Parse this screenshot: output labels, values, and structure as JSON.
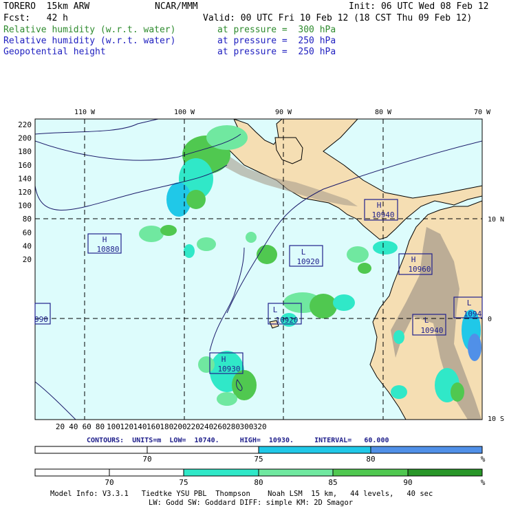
{
  "header": {
    "model": "TORERO  15km ARW",
    "org": "NCAR/MMM",
    "init": "Init: 06 UTC Wed 08 Feb 12",
    "fcst": "Fcst:   42 h",
    "valid": "Valid: 00 UTC Fri 10 Feb 12 (18 CST Thu 09 Feb 12)",
    "fields": [
      {
        "name": "Relative humidity (w.r.t. water)",
        "level": "at pressure =  300 hPa",
        "color": "#2e8b2e"
      },
      {
        "name": "Relative humidity (w.r.t. water)",
        "level": "at pressure =  250 hPa",
        "color": "#2020c0"
      },
      {
        "name": "Geopotential height",
        "level": "at pressure =  250 hPa",
        "color": "#2020c0"
      }
    ]
  },
  "axes": {
    "top_lon_labels": [
      "110 W",
      "100 W",
      "90 W",
      "80 W",
      "70 W"
    ],
    "right_lat_labels": [
      "10 N",
      "0",
      "10 S"
    ],
    "y_ticks": [
      "220",
      "200",
      "180",
      "160",
      "140",
      "120",
      "100",
      "80",
      "60",
      "40",
      "20"
    ],
    "x_ticks": [
      "20",
      "40",
      "60",
      "80",
      "100",
      "120",
      "140",
      "160",
      "180",
      "200",
      "220",
      "240",
      "260",
      "280",
      "300",
      "320"
    ]
  },
  "pressure_centers": [
    {
      "type": "H",
      "value": "10880"
    },
    {
      "type": "L",
      "value": "10920"
    },
    {
      "type": "H",
      "value": "10940"
    },
    {
      "type": "H",
      "value": "10960"
    },
    {
      "type": "L",
      "value": "10920"
    },
    {
      "type": "L",
      "value": "10940"
    },
    {
      "type": "H",
      "value": "10930"
    },
    {
      "type": "L",
      "value": "1094"
    },
    {
      "type": "",
      "value": "990"
    }
  ],
  "contour_info": "CONTOURS:  UNITS=m  LOW=  10740.     HIGH=  10930.     INTERVAL=   60.000",
  "scale1": {
    "labels": [
      "70",
      "75",
      "80"
    ],
    "unit": "%",
    "colors": [
      "#ffffff",
      "#ffffff",
      "#20c8e8",
      "#5090e8"
    ]
  },
  "scale2": {
    "labels": [
      "70",
      "75",
      "80",
      "85",
      "90"
    ],
    "unit": "%",
    "colors": [
      "#ffffff",
      "#ffffff",
      "#30e8c8",
      "#70e8a0",
      "#50c850",
      "#289628"
    ]
  },
  "footer": {
    "line1": "Model Info: V3.3.1   Tiedtke YSU PBL  Thompson    Noah LSM  15 km,   44 levels,   40 sec",
    "line2": "LW: Godd SW: Goddard DIFF: simple KM: 2D Smagor"
  },
  "colors": {
    "ocean": "#ddfcfc",
    "land": "#f5deb3",
    "mountain": "#a89c8c",
    "box": "#20208c"
  }
}
